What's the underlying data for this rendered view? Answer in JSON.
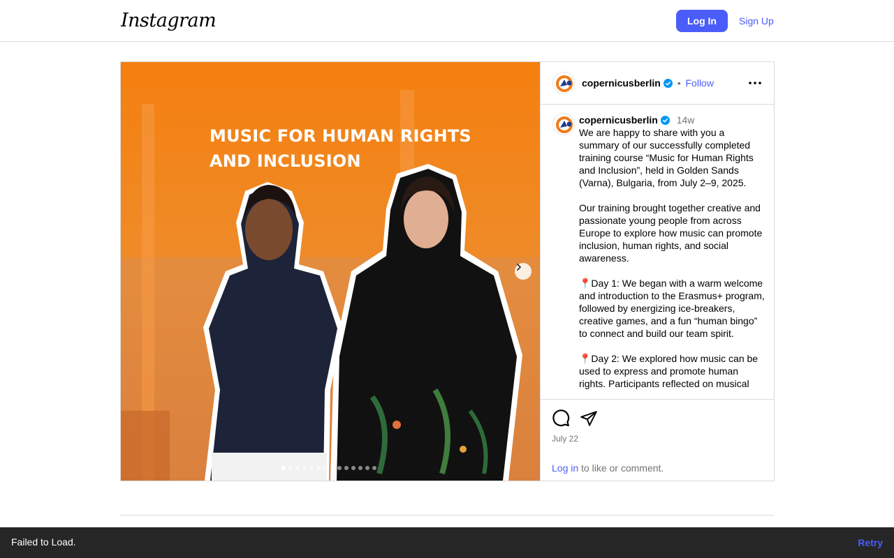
{
  "header": {
    "logo_text": "Instagram",
    "login_label": "Log In",
    "signup_label": "Sign Up"
  },
  "post": {
    "media": {
      "overlay_title_line1": "MUSIC FOR HUMAN RIGHTS",
      "overlay_title_line2": "AND INCLUSION",
      "carousel_count": 14,
      "carousel_active_index": 0
    },
    "author": {
      "username": "copernicusberlin",
      "verified": true,
      "follow_label": "Follow",
      "separator": "•"
    },
    "caption": {
      "username": "copernicusberlin",
      "time_ago": "14w",
      "text": "We are happy to share with you a summary of our successfully completed training course “Music for Human Rights and Inclusion”, held in Golden Sands (Varna), Bulgaria, from July 2–9, 2025.\n\nOur training brought together creative and passionate young people from across Europe to explore how music can promote inclusion, human rights, and social awareness.\n\n📍Day 1: We began with a warm welcome and introduction to the Erasmus+ program, followed by energizing ice-breakers, creative games, and a fun “human bingo” to connect and build our team spirit.\n\n📍Day 2: We explored how music can be used to express and promote human rights. Participants reflected on musical"
    },
    "date": "July 22",
    "login_prompt": {
      "link": "Log in",
      "rest": " to like or comment."
    }
  },
  "toast": {
    "message": "Failed to Load.",
    "action": "Retry"
  },
  "colors": {
    "accent": "#4a5df9",
    "verified": "#0095f6",
    "media_orange": "#f28a1c",
    "toast_bg": "#262626"
  }
}
